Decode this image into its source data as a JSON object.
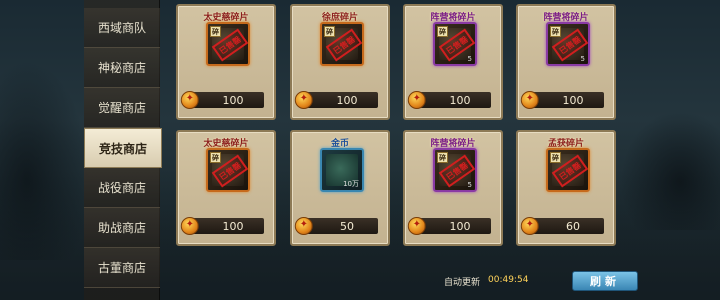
{
  "sidebar": {
    "items": [
      {
        "label": "西域商队",
        "active": false
      },
      {
        "label": "神秘商店",
        "active": false
      },
      {
        "label": "觉醒商店",
        "active": false
      },
      {
        "label": "竞技商店",
        "active": true
      },
      {
        "label": "战役商店",
        "active": false
      },
      {
        "label": "助战商店",
        "active": false
      },
      {
        "label": "古董商店",
        "active": false
      }
    ]
  },
  "shop": {
    "items": [
      {
        "name": "太史慈碎片",
        "frag": "碎",
        "stamp": "已售罄",
        "price": "100",
        "qty": ""
      },
      {
        "name": "徐庶碎片",
        "frag": "碎",
        "stamp": "已售罄",
        "price": "100",
        "qty": ""
      },
      {
        "name": "阵营将碎片",
        "frag": "碎",
        "stamp": "已售罄",
        "price": "100",
        "qty": "5"
      },
      {
        "name": "阵营将碎片",
        "frag": "碎",
        "stamp": "已售罄",
        "price": "100",
        "qty": "5"
      },
      {
        "name": "太史慈碎片",
        "frag": "碎",
        "stamp": "已售罄",
        "price": "100",
        "qty": ""
      },
      {
        "name": "金币",
        "frag": "",
        "stamp": "",
        "price": "50",
        "qty": "10万"
      },
      {
        "name": "阵营将碎片",
        "frag": "碎",
        "stamp": "已售罄",
        "price": "100",
        "qty": "5"
      },
      {
        "name": "孟获碎片",
        "frag": "碎",
        "stamp": "已售罄",
        "price": "60",
        "qty": ""
      }
    ]
  },
  "footer": {
    "auto_refresh_label": "自动更新",
    "timer": "00:49:54",
    "refresh_label": "刷新"
  }
}
